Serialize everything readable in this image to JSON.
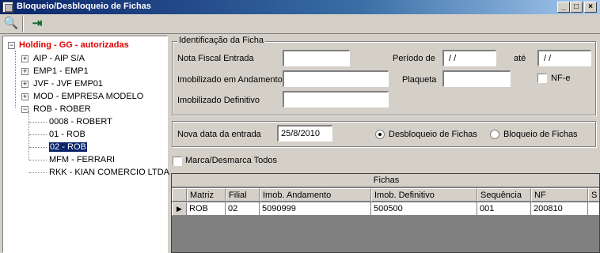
{
  "window": {
    "title": "Bloqueio/Desbloqueio de Fichas",
    "btn_min": "_",
    "btn_max": "□",
    "btn_close": "×"
  },
  "toolbar": {
    "search_glyph": "🔍",
    "exit_glyph": "⇥"
  },
  "tree": {
    "root": "Holding -  GG -  autorizadas",
    "items": [
      "AIP - AIP S/A",
      "EMP1 - EMP1",
      "JVF - JVF  EMP01",
      "MOD - EMPRESA MODELO",
      "ROB - ROBER"
    ],
    "rob_children": [
      "0008 - ROBERT",
      "01 - ROB",
      "02 - ROB",
      "MFM - FERRARI",
      "RKK - KIAN COMERCIO LTDA"
    ]
  },
  "ident": {
    "legend": "Identificação da Ficha",
    "nota_label": "Nota Fiscal Entrada",
    "nota_value": "",
    "imob_andamento_label": "Imobilizado em Andamento",
    "imob_andamento_value": "",
    "imob_definitivo_label": "Imobilizado Definitivo",
    "imob_definitivo_value": "",
    "periodo_label": "Período de",
    "periodo_de": " / /",
    "ate_label": "até",
    "periodo_ate": " / /",
    "plaqueta_label": "Plaqueta",
    "plaqueta_value": "",
    "nfe_label": "NF-e"
  },
  "entrada": {
    "label": "Nova data da entrada",
    "value": "25/8/2010",
    "radio_desbloqueio": "Desbloqueio de Fichas",
    "radio_bloqueio": "Bloqueio de Fichas",
    "selected": "Desbloqueio de Fichas"
  },
  "marca_label": "Marca/Desmarca Todos",
  "grid": {
    "caption": "Fichas",
    "columns": [
      "Matriz",
      "Filial",
      "Imob. Andamento",
      "Imob. Definitivo",
      "Sequência",
      "NF",
      "S"
    ],
    "rows": [
      [
        "ROB",
        "02",
        "5090999",
        "500500",
        "001",
        "200810",
        ""
      ]
    ],
    "row_indicator": "▶"
  }
}
